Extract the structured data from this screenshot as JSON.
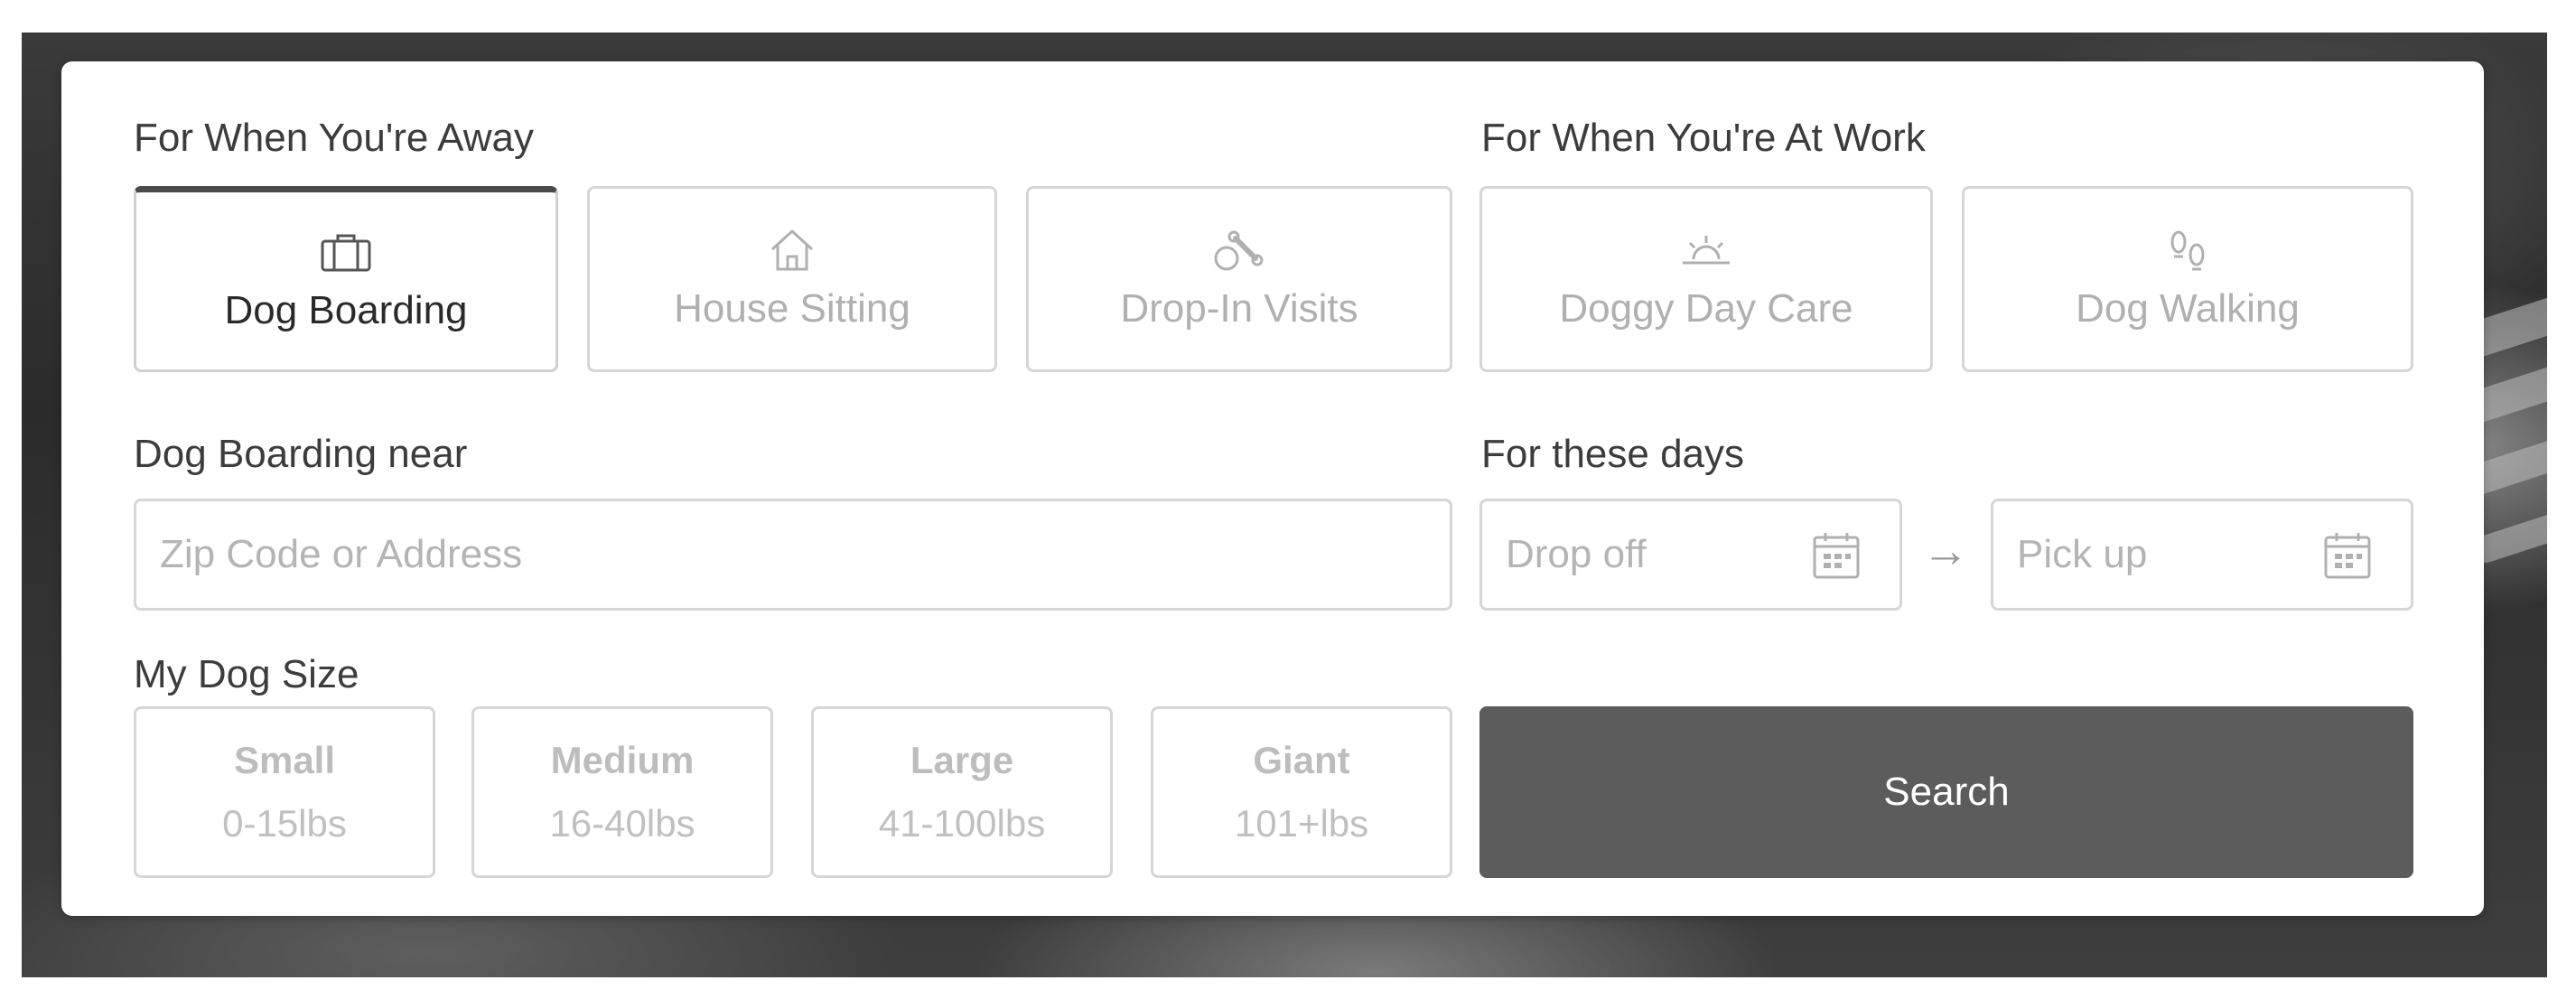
{
  "sections": {
    "away_label": "For When You're Away",
    "work_label": "For When You're At Work",
    "near_label": "Dog Boarding near",
    "days_label": "For these days",
    "size_label": "My Dog Size"
  },
  "services": [
    {
      "label": "Dog Boarding",
      "icon": "suitcase-icon",
      "active": true
    },
    {
      "label": "House Sitting",
      "icon": "house-icon",
      "active": false
    },
    {
      "label": "Drop-In Visits",
      "icon": "ball-and-bone-icon",
      "active": false
    },
    {
      "label": "Doggy Day Care",
      "icon": "sunrise-icon",
      "active": false
    },
    {
      "label": "Dog Walking",
      "icon": "paw-prints-icon",
      "active": false
    }
  ],
  "location": {
    "value": "",
    "placeholder": "Zip Code or Address"
  },
  "dates": {
    "drop_off_placeholder": "Drop off",
    "pick_up_placeholder": "Pick up",
    "arrow": "→"
  },
  "sizes": [
    {
      "name": "Small",
      "range": "0-15lbs"
    },
    {
      "name": "Medium",
      "range": "16-40lbs"
    },
    {
      "name": "Large",
      "range": "41-100lbs"
    },
    {
      "name": "Giant",
      "range": "101+lbs"
    }
  ],
  "search_label": "Search",
  "colors": {
    "active_tab_border": "#4a4a4a",
    "search_button": "#5c5c5c",
    "inactive_text": "#b0b0b0"
  }
}
